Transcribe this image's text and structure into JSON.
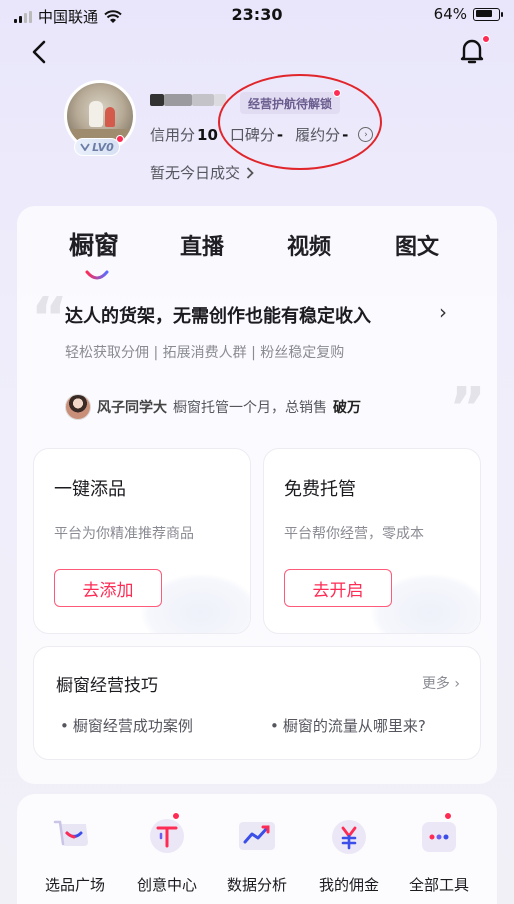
{
  "status_bar": {
    "carrier": "中国联通",
    "time": "23:30",
    "battery": "64%"
  },
  "profile": {
    "level_badge": "LV0",
    "business_tag": "经营护航待解锁",
    "metrics": [
      {
        "label": "信用分",
        "value": "10"
      },
      {
        "label": "口碑分",
        "value": "-"
      },
      {
        "label": "履约分",
        "value": "-"
      }
    ],
    "today_deals": "暂无今日成交"
  },
  "tabs": [
    "橱窗",
    "直播",
    "视频",
    "图文"
  ],
  "promo": {
    "headline": "达人的货架，无需创作也能有稳定收入",
    "subline": "轻松获取分佣 | 拓展消费人群 | 粉丝稳定复购",
    "testimonial_name": "风子同学大",
    "testimonial_text": "橱窗托管一个月，总销售",
    "testimonial_strong": "破万"
  },
  "features": [
    {
      "title": "一键添品",
      "desc": "平台为你精准推荐商品",
      "button": "去添加"
    },
    {
      "title": "免费托管",
      "desc": "平台帮你经营，零成本",
      "button": "去开启"
    }
  ],
  "tips": {
    "title": "橱窗经营技巧",
    "more": "更多",
    "items": [
      "橱窗经营成功案例",
      "橱窗的流量从哪里来?"
    ]
  },
  "tools": [
    {
      "label": "选品广场",
      "icon": "cart-icon"
    },
    {
      "label": "创意中心",
      "icon": "creative-icon"
    },
    {
      "label": "数据分析",
      "icon": "chart-icon"
    },
    {
      "label": "我的佣金",
      "icon": "yen-icon"
    },
    {
      "label": "全部工具",
      "icon": "more-tools-icon"
    }
  ],
  "colors": {
    "accent": "#fe2c55",
    "annotation": "#e0262b"
  }
}
